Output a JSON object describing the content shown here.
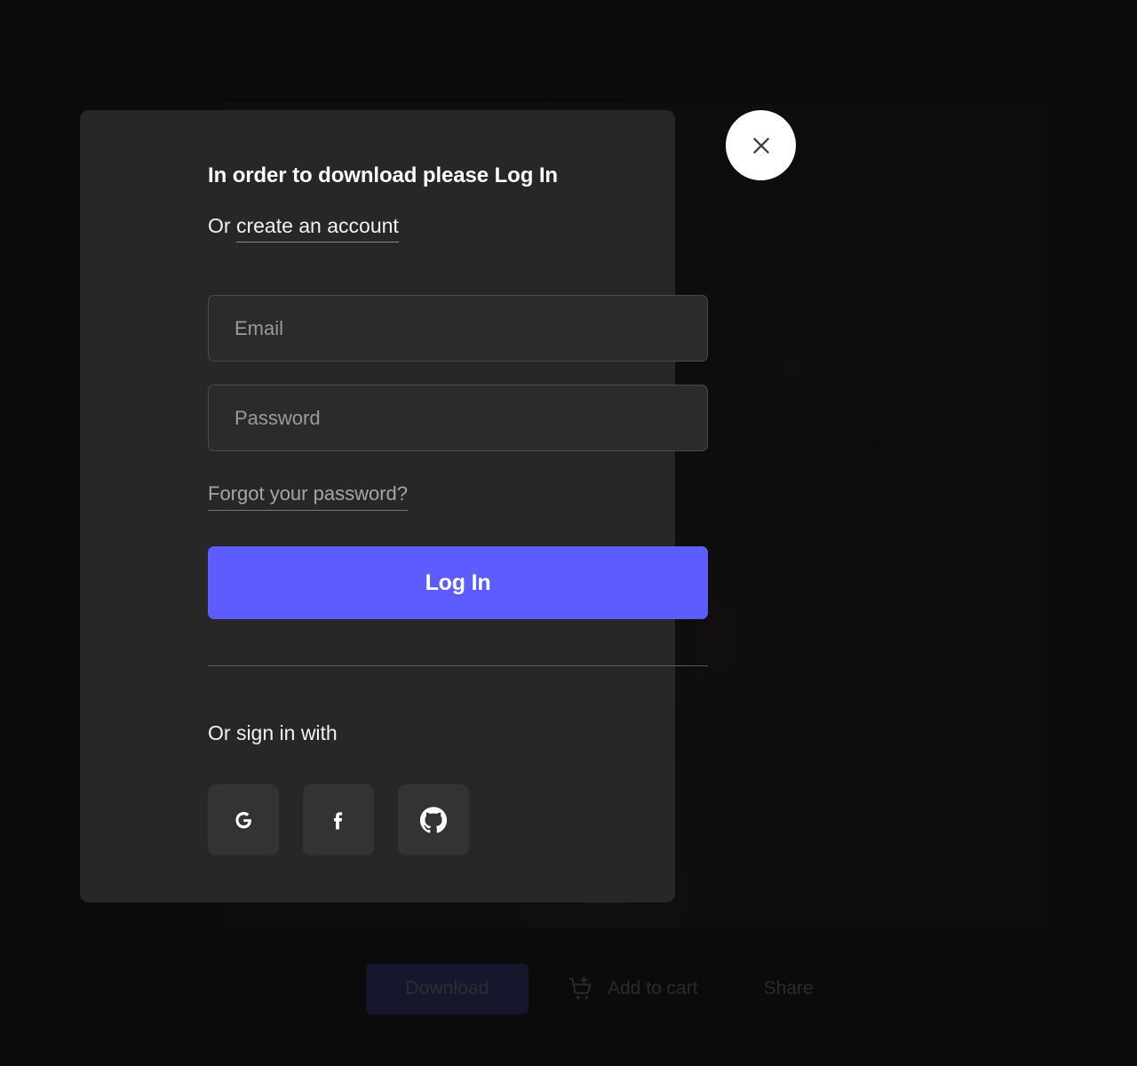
{
  "page": {
    "background_color": "#131313",
    "accent_color": "#5D5DFF"
  },
  "media": {
    "alt": "portrait-photo"
  },
  "toolbar": {
    "download_label": "Download",
    "add_to_cart_label": "Add to cart",
    "cart_icon": "cart-plus-icon",
    "share_label": "Share"
  },
  "close_button": {
    "icon": "close-icon",
    "label": "Close"
  },
  "modal": {
    "title": "In order to download please Log In",
    "create_prefix": "Or ",
    "create_link_label": "create an account",
    "email": {
      "placeholder": "Email",
      "value": ""
    },
    "password": {
      "placeholder": "Password",
      "value": ""
    },
    "forgot_label": "Forgot your password?",
    "submit_label": "Log In",
    "social_heading": "Or sign in with",
    "social_buttons": [
      {
        "name": "google",
        "icon": "google-icon",
        "label": "Sign in with Google"
      },
      {
        "name": "facebook",
        "icon": "facebook-icon",
        "label": "Sign in with Facebook"
      },
      {
        "name": "github",
        "icon": "github-icon",
        "label": "Sign in with GitHub"
      }
    ]
  }
}
